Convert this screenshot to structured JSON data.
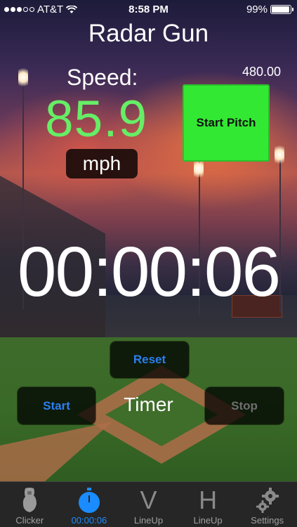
{
  "status_bar": {
    "carrier": "AT&T",
    "time": "8:58 PM",
    "battery": "99%"
  },
  "app": {
    "title": "Radar Gun"
  },
  "speed": {
    "label": "Speed:",
    "value": "85.9",
    "unit": "mph",
    "secondary_value": "480.00",
    "start_pitch_label": "Start Pitch"
  },
  "timer": {
    "display": "00:00:06",
    "label": "Timer",
    "reset_label": "Reset",
    "start_label": "Start",
    "stop_label": "Stop"
  },
  "tabs": [
    {
      "label": "Clicker",
      "icon": "clicker-icon"
    },
    {
      "label": "00:00:06",
      "icon": "stopwatch-icon",
      "active": true
    },
    {
      "label": "LineUp",
      "icon": "v-letter-icon"
    },
    {
      "label": "LineUp",
      "icon": "h-letter-icon"
    },
    {
      "label": "Settings",
      "icon": "gears-icon"
    }
  ],
  "colors": {
    "speed_green": "#66ee66",
    "start_pitch_green": "#33e833",
    "active_tab_blue": "#1a8cff",
    "button_text_blue": "#2a7ff0"
  }
}
